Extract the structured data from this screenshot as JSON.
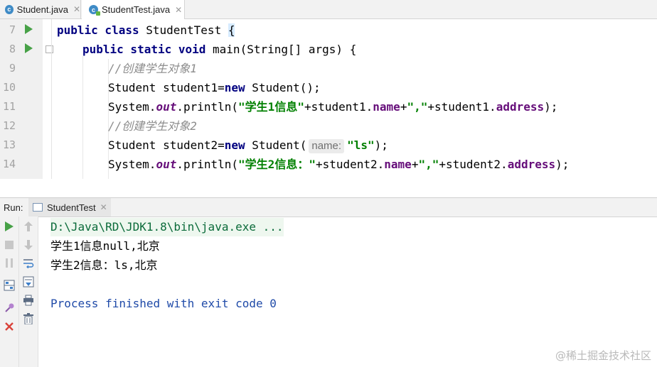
{
  "tabs": [
    {
      "label": "Student.java",
      "icon": "c-icon"
    },
    {
      "label": "StudentTest.java",
      "icon": "c-icon"
    }
  ],
  "editor": {
    "line_numbers": [
      "7",
      "8",
      "9",
      "10",
      "11",
      "12",
      "13",
      "14"
    ],
    "lines": {
      "l7": {
        "kw": "public class ",
        "name": "StudentTest ",
        "brace": "{"
      },
      "l8": {
        "kw": "public static void ",
        "rest": "main(String[] args) {"
      },
      "l9": {
        "comment": "//创建学生对象1"
      },
      "l10": {
        "a": "Student student1=",
        "kw": "new",
        "b": " Student();"
      },
      "l11": {
        "a": "System.",
        "stat": "out",
        "b": ".println(",
        "s1": "\"学生1信息\"",
        "c": "+student1.",
        "f1": "name",
        "d": "+",
        "s2": "\",\"",
        "e": "+student1.",
        "f2": "address",
        "g": ");"
      },
      "l12": {
        "comment": "//创建学生对象2"
      },
      "l13": {
        "a": "Student student2=",
        "kw": "new",
        "b": " Student(",
        "hint": "name:",
        "s1": "\"ls\"",
        "c": ");"
      },
      "l14": {
        "a": "System.",
        "stat": "out",
        "b": ".println(",
        "s1": "\"学生2信息：\"",
        "c": "+student2.",
        "f1": "name",
        "d": "+",
        "s2": "\",\"",
        "e": "+student2.",
        "f2": "address",
        "g": ");"
      }
    }
  },
  "run_panel": {
    "label": "Run:",
    "tab_label": "StudentTest",
    "output": {
      "cmd": "D:\\Java\\RD\\JDK1.8\\bin\\java.exe ...",
      "line1": "学生1信息null,北京",
      "line2": "学生2信息：ls,北京",
      "finish": "Process finished with exit code 0"
    }
  },
  "watermark": "@稀土掘金技术社区",
  "colors": {
    "keyword": "#000080",
    "string": "#008000",
    "field": "#660e7a",
    "comment": "#8c8c8c",
    "run_green": "#47a147",
    "stop_red": "#d9423a"
  }
}
